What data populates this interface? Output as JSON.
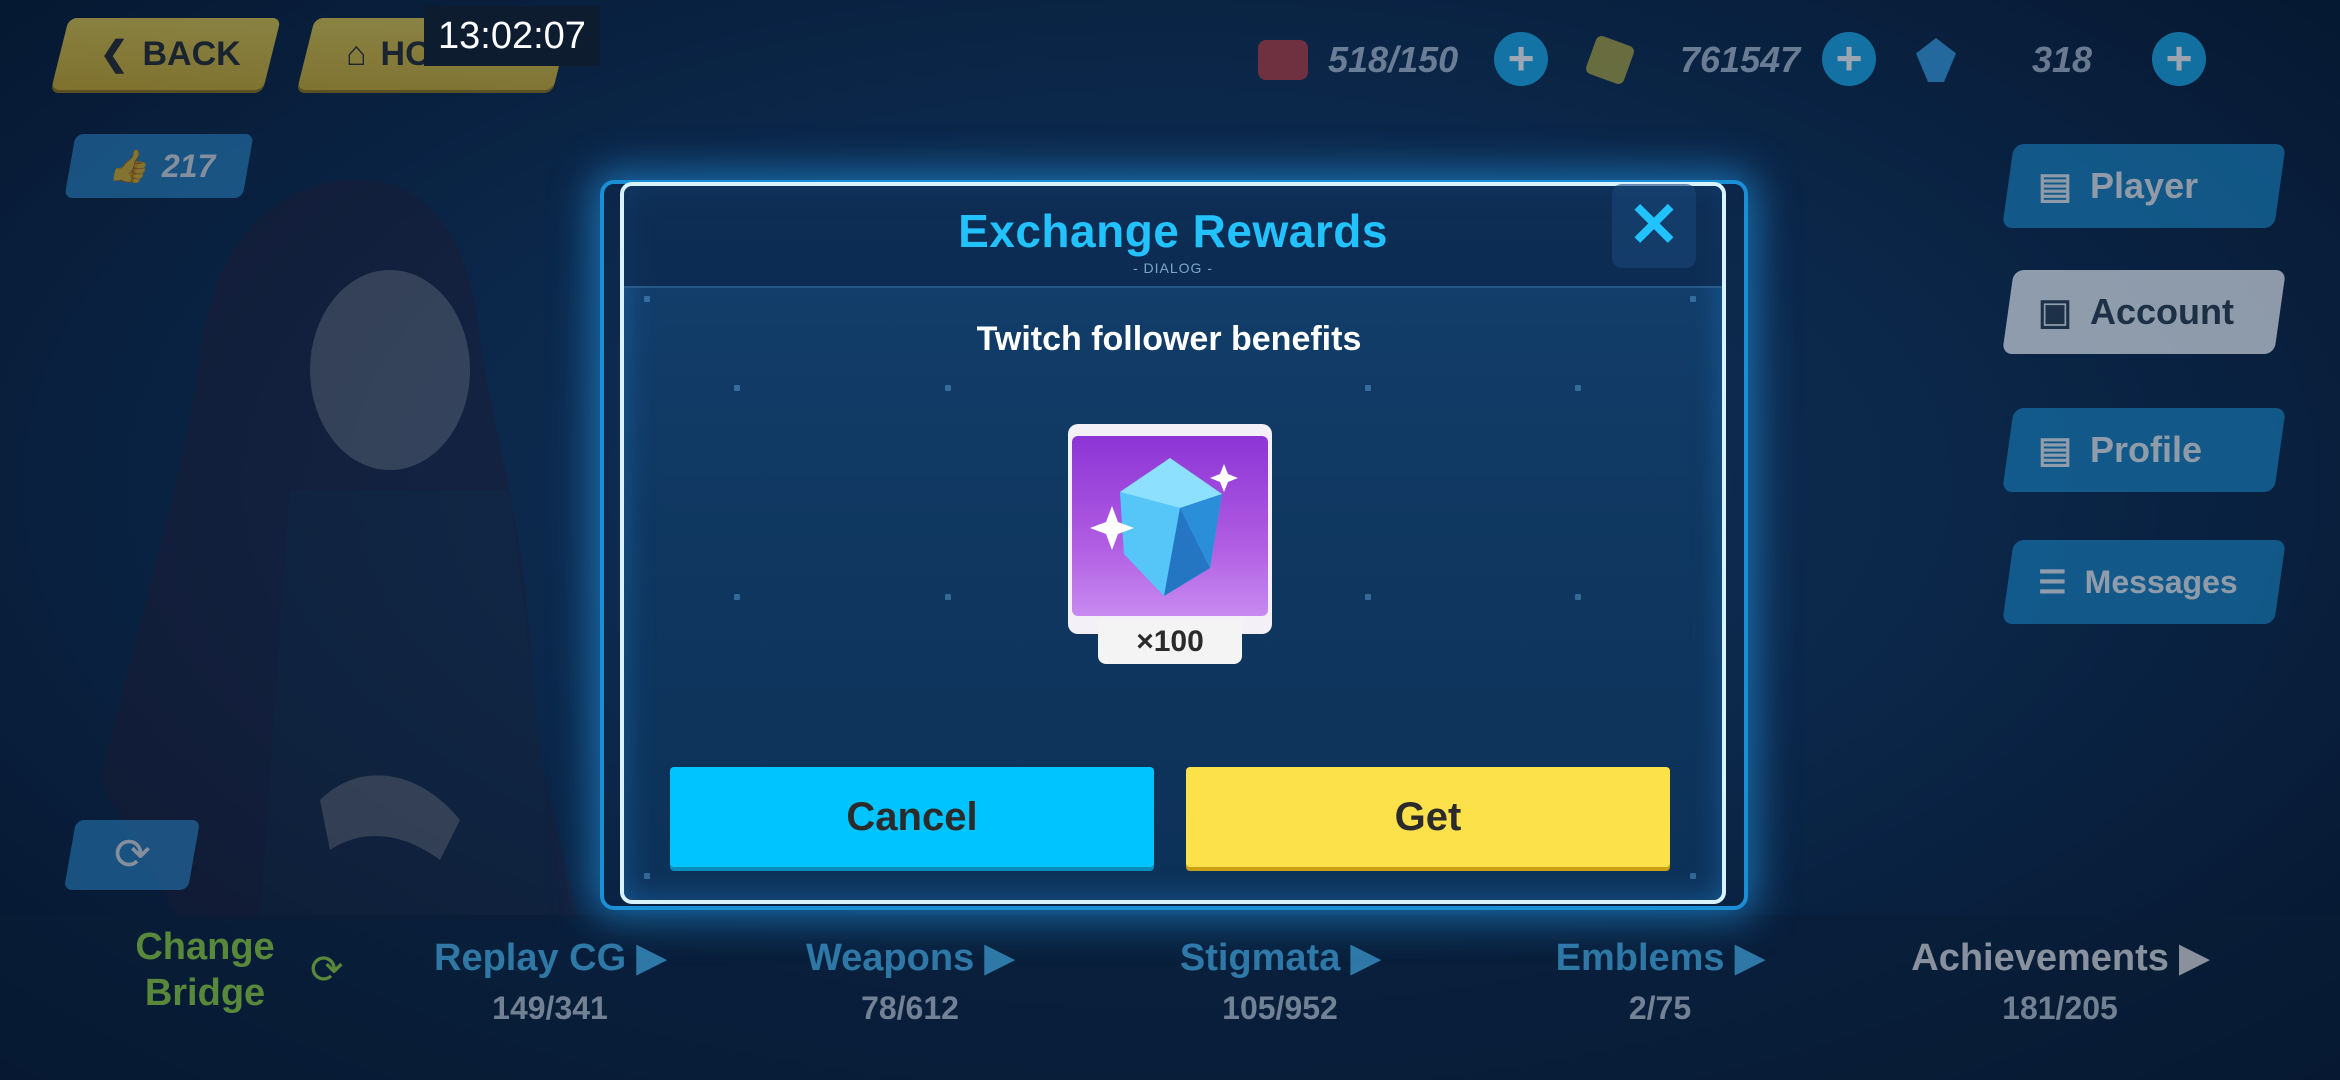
{
  "status_bar": {
    "time": "13:02:07"
  },
  "top_nav": {
    "back_label": "BACK",
    "home_label": "HOME"
  },
  "resources": [
    {
      "icon": "stamina-icon",
      "value": "518/150"
    },
    {
      "icon": "coin-icon",
      "value": "761547"
    },
    {
      "icon": "crystal-icon",
      "value": "318"
    }
  ],
  "likes": {
    "count": "217"
  },
  "side_menu": [
    {
      "label": "Player",
      "icon": "id-card-icon",
      "active": false
    },
    {
      "label": "Account",
      "icon": "lock-icon",
      "active": true
    },
    {
      "label": "Profile",
      "icon": "profile-card-icon",
      "active": false
    },
    {
      "label": "Messages",
      "icon": "list-icon",
      "active": false
    }
  ],
  "bottom_bar": {
    "change_bridge": "Change Bridge",
    "stats": [
      {
        "label": "Replay CG",
        "value": "149/341"
      },
      {
        "label": "Weapons",
        "value": "78/612"
      },
      {
        "label": "Stigmata",
        "value": "105/952"
      },
      {
        "label": "Emblems",
        "value": "2/75"
      },
      {
        "label": "Achievements",
        "value": "181/205"
      }
    ]
  },
  "dialog": {
    "title": "Exchange Rewards",
    "subtitle": "- DIALOG -",
    "description": "Twitch follower benefits",
    "reward": {
      "icon": "crystal-icon",
      "quantity": "×100"
    },
    "cancel_label": "Cancel",
    "get_label": "Get"
  },
  "colors": {
    "accent_cyan": "#00c4ff",
    "accent_yellow": "#fde14b",
    "title_cyan": "#22c2ff"
  }
}
